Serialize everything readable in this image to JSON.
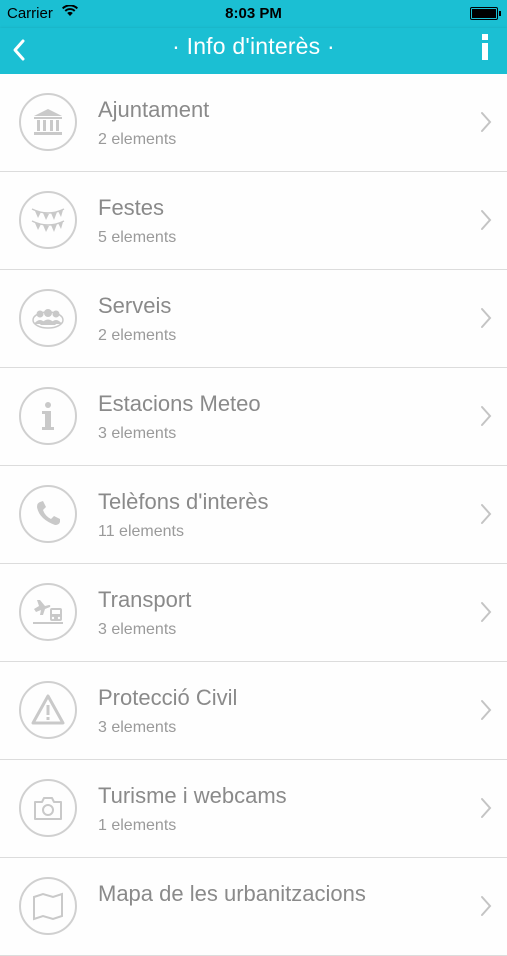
{
  "status_bar": {
    "carrier": "Carrier",
    "time": "8:03 PM"
  },
  "nav": {
    "title": "· Info d'interès ·",
    "back_icon": "chevron-left-icon",
    "info_icon": "info-icon",
    "color": "#1bbfd3"
  },
  "items": [
    {
      "label": "Ajuntament",
      "count": "2 elements",
      "icon": "town-hall-icon"
    },
    {
      "label": "Festes",
      "count": "5 elements",
      "icon": "bunting-icon"
    },
    {
      "label": "Serveis",
      "count": "2 elements",
      "icon": "people-group-icon"
    },
    {
      "label": "Estacions Meteo",
      "count": "3 elements",
      "icon": "info-icon"
    },
    {
      "label": "Telèfons d'interès",
      "count": "11 elements",
      "icon": "phone-icon"
    },
    {
      "label": "Transport",
      "count": "3 elements",
      "icon": "transport-icon"
    },
    {
      "label": "Protecció Civil",
      "count": "3 elements",
      "icon": "warning-icon"
    },
    {
      "label": "Turisme i webcams",
      "count": "1 elements",
      "icon": "camera-icon"
    },
    {
      "label": "Mapa de les urbanitzacions",
      "count": "",
      "icon": "map-icon"
    }
  ]
}
